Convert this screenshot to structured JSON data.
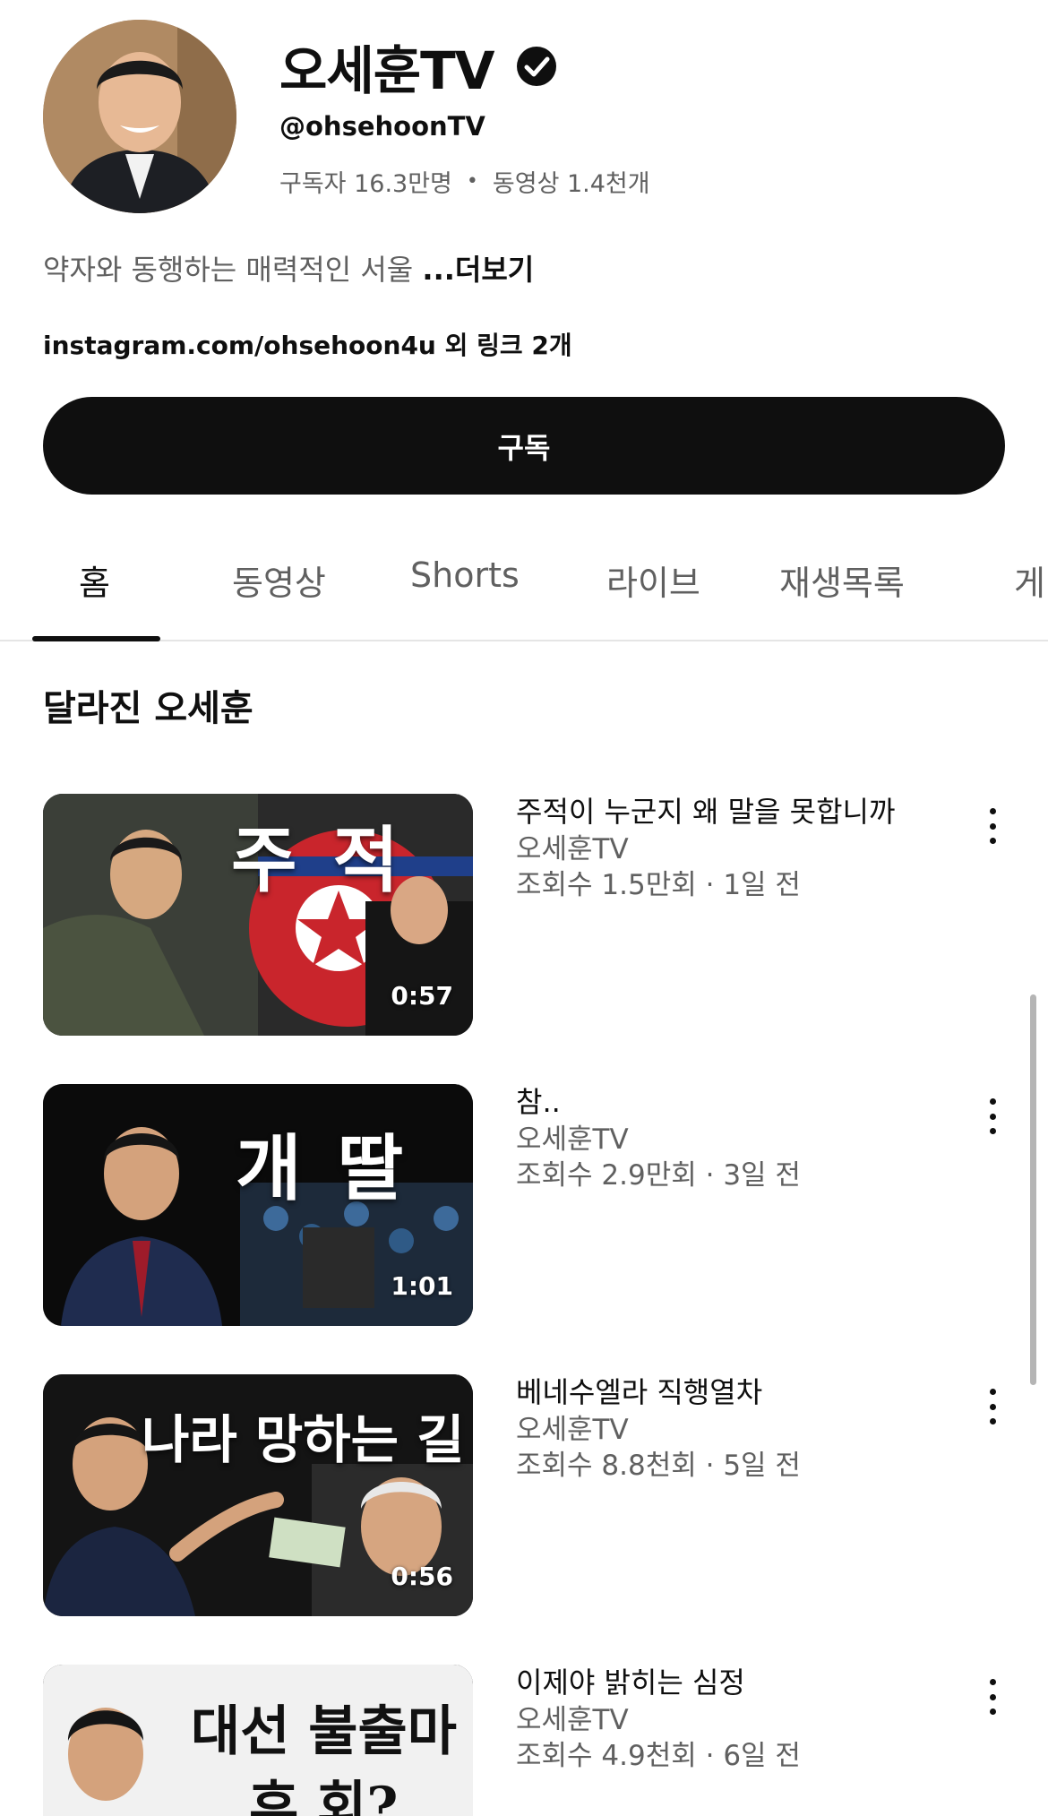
{
  "channel": {
    "name": "오세훈TV",
    "handle": "@ohsehoonTV",
    "subscribers": "구독자 16.3만명",
    "separator": "•",
    "video_count": "동영상 1.4천개",
    "description": "약자와 동행하는 매력적인 서울 ",
    "more_label": "...더보기",
    "links": "instagram.com/ohsehoon4u 외 링크 2개",
    "subscribe_label": "구독"
  },
  "tabs": [
    {
      "label": "홈",
      "active": true
    },
    {
      "label": "동영상"
    },
    {
      "label": "Shorts"
    },
    {
      "label": "라이브"
    },
    {
      "label": "재생목록"
    },
    {
      "label": "게"
    }
  ],
  "section": {
    "title": "달라진 오세훈"
  },
  "videos": [
    {
      "title": "주적이 누군지 왜 말을 못합니까",
      "channel": "오세훈TV",
      "info": "조회수 1.5만회 · 1일 전",
      "duration": "0:57",
      "thumb_text": "주 적"
    },
    {
      "title": "참..",
      "channel": "오세훈TV",
      "info": "조회수 2.9만회 · 3일 전",
      "duration": "1:01",
      "thumb_text": "개 딸"
    },
    {
      "title": "베네수엘라 직행열차",
      "channel": "오세훈TV",
      "info": "조회수 8.8천회 · 5일 전",
      "duration": "0:56",
      "thumb_text": "나라 망하는 길"
    },
    {
      "title": "이제야 밝히는 심정",
      "channel": "오세훈TV",
      "info": "조회수 4.9천회 · 6일 전",
      "duration": "",
      "thumb_text_1": "대선 불출마",
      "thumb_text_2": "후 회?"
    }
  ],
  "icons": {
    "verified": "verified-check-icon",
    "more": "more-vert-icon"
  },
  "colors": {
    "primary_text": "#0f0f0f",
    "secondary_text": "#606060",
    "subscribe_bg": "#0f0f0f",
    "background": "#ffffff"
  }
}
